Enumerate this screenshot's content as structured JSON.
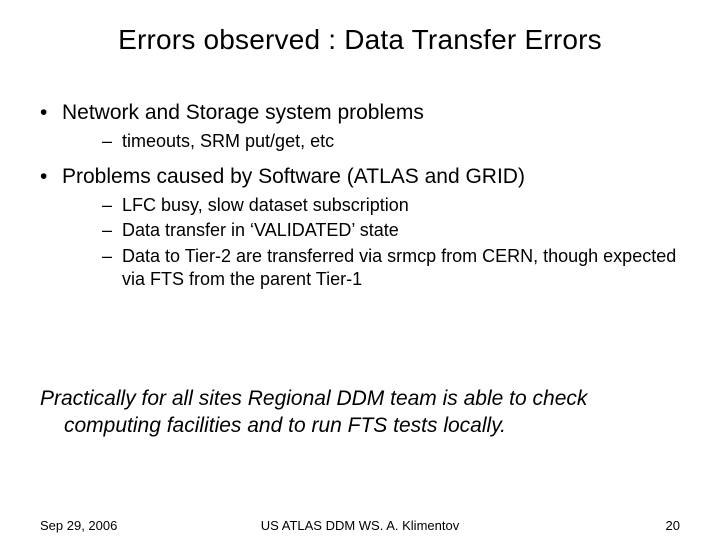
{
  "title": "Errors observed : Data Transfer Errors",
  "bullets": [
    {
      "text": "Network and Storage system problems",
      "sub": [
        "timeouts, SRM put/get, etc"
      ]
    },
    {
      "text": "Problems caused by Software (ATLAS and GRID)",
      "sub": [
        "LFC busy, slow dataset subscription",
        "Data transfer in ‘VALIDATED’ state",
        "Data to Tier-2 are transferred via srmcp from CERN, though expected via FTS from the parent Tier-1"
      ]
    }
  ],
  "closing_line1": "Practically for all sites  Regional DDM team is able to check",
  "closing_line2": "computing  facilities and to run FTS tests locally.",
  "footer": {
    "date": "Sep  29, 2006",
    "center": "US ATLAS DDM WS. A. Klimentov",
    "page": "20"
  }
}
